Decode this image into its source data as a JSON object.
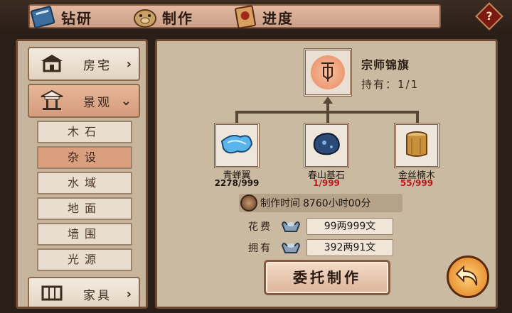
{
  "tabs": [
    {
      "label": "钻研",
      "icon": "book-icon"
    },
    {
      "label": "制作",
      "icon": "pig-icon"
    },
    {
      "label": "进度",
      "icon": "scroll-icon"
    }
  ],
  "help_label": "?",
  "sidebar": {
    "categories": [
      {
        "label": "房宅",
        "icon": "house-icon",
        "arrow": "›"
      },
      {
        "label": "景观",
        "icon": "pavilion-icon",
        "arrow": "⌄"
      },
      {
        "label": "家具",
        "icon": "furniture-icon",
        "arrow": "›"
      }
    ],
    "subitems": [
      "木石",
      "杂设",
      "水域",
      "地面",
      "墙围",
      "光源"
    ],
    "active_subitem": "杂设"
  },
  "product": {
    "name": "宗师锦旗",
    "hold_label": "持有：",
    "hold_value": "1/1",
    "icon": "banner-icon"
  },
  "materials": [
    {
      "name": "青蝉翼",
      "count": "2278/999",
      "status": "ok",
      "icon": "blue-silk-icon"
    },
    {
      "name": "春山基石",
      "count": "1/999",
      "status": "short",
      "icon": "blue-stone-icon"
    },
    {
      "name": "金丝楠木",
      "count": "55/999",
      "status": "short",
      "icon": "wood-stump-icon"
    }
  ],
  "craft_time": {
    "label": "制作时间",
    "value": "8760小时00分"
  },
  "cost": {
    "label": "花费",
    "value": "99两999文"
  },
  "owned": {
    "label": "拥有",
    "value": "392两91文"
  },
  "craft_button": "委托制作",
  "colors": {
    "short": "#b8181a",
    "accent": "#d99f7e"
  }
}
